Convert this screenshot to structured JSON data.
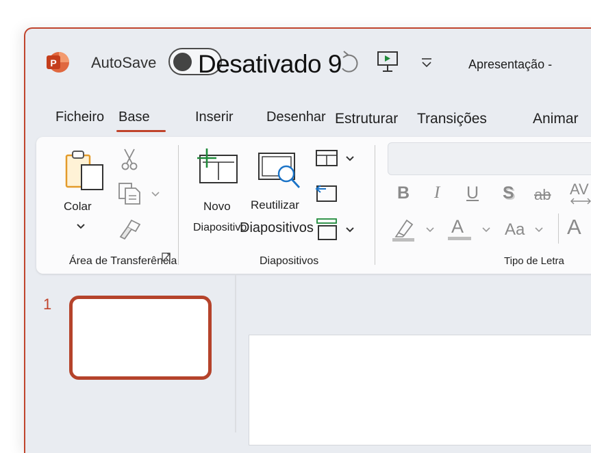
{
  "title_bar": {
    "autosave_label": "AutoSave",
    "autosave_state": "Desativado",
    "redo_fragment": "9",
    "document_title": "Apresentação -"
  },
  "tabs": [
    {
      "label": "Ficheiro"
    },
    {
      "label": "Base",
      "active": true
    },
    {
      "label": "Inserir"
    },
    {
      "label": "Desenhar"
    },
    {
      "label": "Estruturar"
    },
    {
      "label": "Transições"
    },
    {
      "label": "Animar"
    }
  ],
  "ribbon": {
    "clipboard": {
      "paste_label": "Colar",
      "group_label": "Área de Transferência"
    },
    "slides": {
      "new_slide_line1": "Novo",
      "new_slide_line2": "Diapositivo",
      "reuse_line1": "Reutilizar",
      "reuse_line2": "Diapositivos",
      "group_label": "Diapositivos"
    },
    "font": {
      "bold": "B",
      "italic": "I",
      "underline": "U",
      "shadow": "S",
      "strike": "ab",
      "spacing": "AV",
      "font_color_letter": "A",
      "change_case": "Aa",
      "grow_font": "A",
      "group_label": "Tipo de Letra"
    }
  },
  "slides_pane": {
    "slide_number": "1"
  },
  "colors": {
    "accent": "#c0432b",
    "window_bg": "#e9ecf1",
    "ribbon_bg": "#fbfbfc",
    "new_slide_plus": "#1e8a3a",
    "reuse_magnifier": "#1a73c7"
  },
  "icons": [
    "powerpoint-logo-icon",
    "redo-icon",
    "present-from-start-icon",
    "customize-qat-icon",
    "paste-clipboard-icon",
    "cut-scissors-icon",
    "copy-icon",
    "format-painter-icon",
    "new-slide-icon",
    "reuse-slides-icon",
    "layout-icon",
    "reset-icon",
    "section-icon",
    "highlight-icon",
    "font-color-icon",
    "chevron-down-icon"
  ]
}
